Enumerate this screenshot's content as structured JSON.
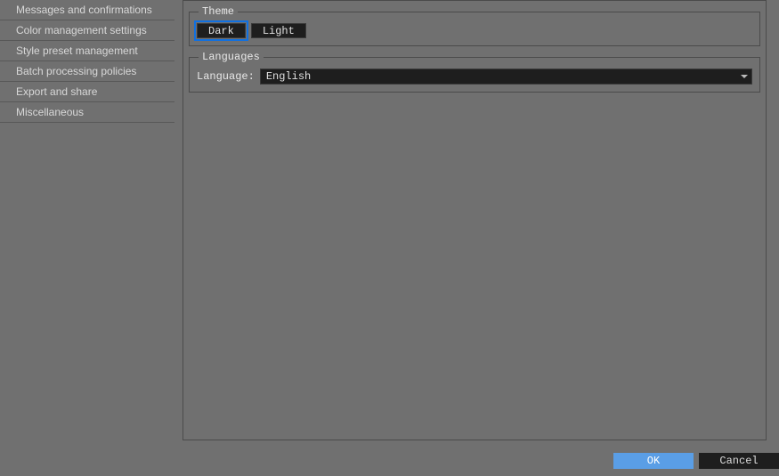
{
  "sidebar": {
    "items": [
      {
        "label": "Messages and confirmations"
      },
      {
        "label": "Color management settings"
      },
      {
        "label": "Style preset management"
      },
      {
        "label": "Batch processing policies"
      },
      {
        "label": "Export and share"
      },
      {
        "label": "Miscellaneous"
      }
    ]
  },
  "theme": {
    "legend": "Theme",
    "dark_label": "Dark",
    "light_label": "Light",
    "selected": "Dark"
  },
  "languages": {
    "legend": "Languages",
    "label": "Language:",
    "value": "English"
  },
  "footer": {
    "ok_label": "OK",
    "cancel_label": "Cancel"
  }
}
